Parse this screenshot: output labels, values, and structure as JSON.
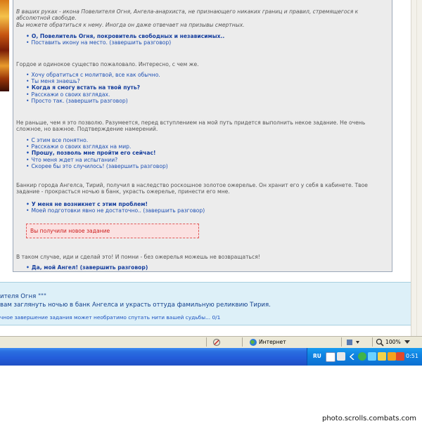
{
  "dialog": {
    "intro_1": "В ваших руках - икона Повелителя Огня, Ангела-анархиста, не признающего никаких границ и правил, стремящегося к абсолютной свободе.",
    "intro_2": "Вы можете обратиться к нему. Иногда он даже отвечает на призывы смертных.",
    "options_1": [
      {
        "label": "О, Повелитель Огня, покровитель свободных и независимых..",
        "bold": true
      },
      {
        "label": "Поставить икону на место. (завершить разговор)",
        "bold": false
      }
    ],
    "reply_1": "Гордое и одинокое существо пожаловало. Интересно, с чем же.",
    "options_2": [
      {
        "label": "Хочу обратиться с молитвой, все как обычно.",
        "bold": false
      },
      {
        "label": "Ты меня знаешь?",
        "bold": false
      },
      {
        "label": "Когда я смогу встать на твой путь?",
        "bold": true
      },
      {
        "label": "Расскажи о своих взглядах.",
        "bold": false
      },
      {
        "label": "Просто так. (завершить разговор)",
        "bold": false
      }
    ],
    "reply_2": "Не раньше, чем я это позволю. Разумеется, перед вступлением на мой путь придется выполнить некое задание. Не очень сложное, но важное. Подтверждение намерений.",
    "options_3": [
      {
        "label": "С этим все понятно.",
        "bold": false
      },
      {
        "label": "Расскажи о своих взглядах на мир.",
        "bold": false
      },
      {
        "label": "Прошу, позволь мне пройти его сейчас!",
        "bold": true
      },
      {
        "label": "Что меня ждет на испытании?",
        "bold": false
      },
      {
        "label": "Скорее бы это случилось! (завершить разговор)",
        "bold": false
      }
    ],
    "reply_3": "Банкир города Ангелса, Тирий, получил в наследство роскошное золотое ожерелье. Он хранит его у себя в кабинете. Твое задание - прокрасться ночью в банк, украсть ожерелье, принести его мне.",
    "options_4": [
      {
        "label": "У меня не возникнет с этим проблем!",
        "bold": true
      },
      {
        "label": "Моей подготовки явно не достаточно.. (завершить разговор)",
        "bold": false
      }
    ],
    "notice": "Вы получили новое задание",
    "reply_4": "В таком случае, иди и сделай это! И помни - без ожерелья можешь не возвращаться!",
    "options_5": [
      {
        "label": "Да, мой Ангел! (завершить разговор)",
        "bold": true
      }
    ]
  },
  "chat": {
    "line_1": "ителя Огня \"\"\"",
    "line_2": "вам заглянуть ночью в банк Ангелса и украсть оттуда фамильную реликвию Тирия.",
    "line_3": "чное завершение задания может необратимо спутать нити вашей судьбы... 0/1"
  },
  "statusbar": {
    "zone": "Интернет",
    "zoom": "100%"
  },
  "taskbar": {
    "lang": "RU",
    "clock": "0:51"
  },
  "watermark": "photo.scrolls.combats.com"
}
